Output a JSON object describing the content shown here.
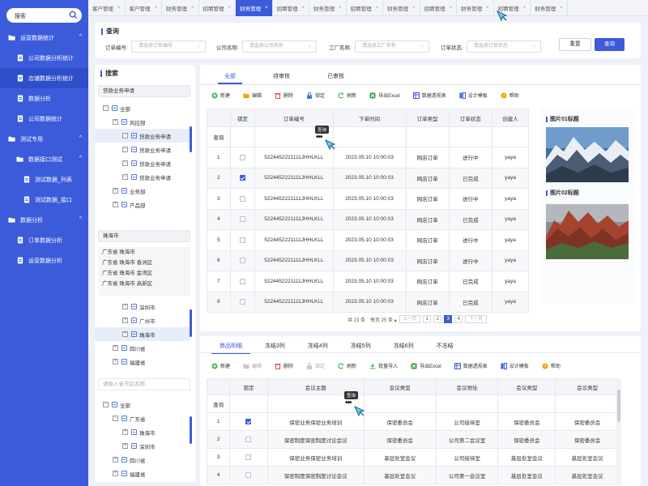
{
  "sidebar": {
    "search_placeholder": "搜索",
    "items": [
      {
        "label": "运营数据统计",
        "level": 0,
        "icon": "folder-icon",
        "caret": "^"
      },
      {
        "label": "公司数据分析统计",
        "level": 1,
        "icon": "doc-icon"
      },
      {
        "label": "店铺数据分析统计",
        "level": 1,
        "icon": "doc-icon",
        "active": true
      },
      {
        "label": "数据分析",
        "level": 1,
        "icon": "doc-icon"
      },
      {
        "label": "公司数据统计",
        "level": 1,
        "icon": "doc-icon"
      },
      {
        "label": "测试专用",
        "level": 0,
        "icon": "folder-icon",
        "caret": "^"
      },
      {
        "label": "数据接口测试",
        "level": 1,
        "icon": "folder-icon",
        "caret": "^"
      },
      {
        "label": "测试数据_列表",
        "level": 2,
        "icon": "doc-icon"
      },
      {
        "label": "测试数据_接口",
        "level": 2,
        "icon": "doc-icon"
      },
      {
        "label": "数据分析",
        "level": 0,
        "icon": "folder-icon",
        "caret": "^"
      },
      {
        "label": "订单数据分析",
        "level": 1,
        "icon": "doc-icon"
      },
      {
        "label": "运营数据分析",
        "level": 1,
        "icon": "doc-icon"
      }
    ]
  },
  "tabs": [
    {
      "label": "客户管理"
    },
    {
      "label": "客户管理"
    },
    {
      "label": "财务管理"
    },
    {
      "label": "招聘管理"
    },
    {
      "label": "财务管理",
      "active": true
    },
    {
      "label": "招聘管理"
    },
    {
      "label": "财务管理"
    },
    {
      "label": "招聘管理"
    },
    {
      "label": "财务管理"
    },
    {
      "label": "招聘管理"
    },
    {
      "label": "财务管理"
    },
    {
      "label": "招聘管理"
    },
    {
      "label": "财务管理"
    }
  ],
  "tab_close": "×",
  "query": {
    "title": "查询",
    "fields": [
      {
        "label": "订单编号:",
        "placeholder": "请选择订单编号"
      },
      {
        "label": "公司名称:",
        "placeholder": "请选择公司名称"
      },
      {
        "label": "工厂名称:",
        "placeholder": "请选择工厂名称"
      },
      {
        "label": "订单状态:",
        "placeholder": "请选择订单状态"
      }
    ],
    "reset_label": "重置",
    "search_label": "查询"
  },
  "leftpanel": {
    "title": "搜索",
    "dept_input": "贷款业务申请",
    "dept_tree": [
      {
        "label": "全部",
        "toggle": "−",
        "indent": 0
      },
      {
        "label": "风控部",
        "toggle": "+",
        "indent": 1
      },
      {
        "label": "贷款业务申请",
        "toggle": "−",
        "indent": 2,
        "sel": true
      },
      {
        "label": "贷款业务申请",
        "toggle": "−",
        "indent": 2
      },
      {
        "label": "贷款业务申请",
        "toggle": "−",
        "indent": 2
      },
      {
        "label": "贷款业务申请",
        "toggle": "−",
        "indent": 2
      },
      {
        "label": "业务部",
        "toggle": "+",
        "indent": 1
      },
      {
        "label": "产品部",
        "toggle": "+",
        "indent": 1
      }
    ],
    "city_input": "珠海市",
    "region_lines": [
      "广东省 珠海市",
      "广东省 珠海市 香洲区",
      "广东省 珠海市 金湾区",
      "广东省 珠海市 高新区"
    ],
    "city_tree": [
      {
        "label": "深圳市",
        "toggle": "+",
        "indent": 2
      },
      {
        "label": "广州市",
        "toggle": "+",
        "indent": 2
      },
      {
        "label": "珠海市",
        "toggle": "+",
        "indent": 2,
        "sel": true
      },
      {
        "label": "四川省",
        "toggle": "+",
        "indent": 1
      },
      {
        "label": "福建省",
        "toggle": "+",
        "indent": 1
      }
    ],
    "province_placeholder": "请输入省市区名称",
    "prov_tree": [
      {
        "label": "全部",
        "toggle": "−",
        "indent": 0
      },
      {
        "label": "广东省",
        "toggle": "−",
        "indent": 1
      },
      {
        "label": "珠海市",
        "toggle": "+",
        "indent": 2
      },
      {
        "label": "深圳市",
        "toggle": "+",
        "indent": 2
      },
      {
        "label": "四川省",
        "toggle": "+",
        "indent": 1
      },
      {
        "label": "福建省",
        "toggle": "+",
        "indent": 1
      }
    ]
  },
  "main": {
    "subtabs": [
      "全部",
      "待审核",
      "已审核"
    ],
    "toolbar": [
      {
        "label": "新建",
        "icon": "plus-circle-icon",
        "color": "#3cb44b"
      },
      {
        "label": "编辑",
        "icon": "folder-edit-icon",
        "color": "#f0a500"
      },
      {
        "label": "删除",
        "icon": "delete-icon",
        "color": "#e04848"
      },
      {
        "label": "锁定",
        "icon": "lock-icon",
        "color": "#3b7ce8"
      },
      {
        "label": "刷新",
        "icon": "refresh-icon",
        "color": "#3cb44b"
      },
      {
        "label": "导出Excel",
        "icon": "excel-icon",
        "color": "#2f9e44"
      },
      {
        "label": "数据透视表",
        "icon": "pivot-icon",
        "color": "#3b5bdb"
      },
      {
        "label": "设计模板",
        "icon": "template-icon",
        "color": "#3b5bdb"
      },
      {
        "label": "帮助",
        "icon": "help-icon",
        "color": "#f0a500"
      }
    ],
    "headers": [
      "",
      "锁定",
      "订单编号",
      "下单时间",
      "订单类型",
      "订单状态",
      "创建人"
    ],
    "filter_label": "查询",
    "tooltip": "查询",
    "dots": "•••",
    "rows": [
      {
        "n": "1",
        "checked": false,
        "order": "5224452221111JHHLKLL",
        "time": "2023.05.10 10:00:03",
        "type": "网店订单",
        "status": "进行中",
        "status_kind": "run",
        "creator": "yaya"
      },
      {
        "n": "2",
        "checked": true,
        "order": "5224452221111JHHLKLL",
        "time": "2023.05.10 10:00:03",
        "type": "网店订单",
        "status": "已完成",
        "status_kind": "done",
        "creator": "yaya"
      },
      {
        "n": "3",
        "checked": false,
        "order": "5224452221111JHHLKLL",
        "time": "2023.05.10 10:00:03",
        "type": "网店订单",
        "status": "进行中",
        "status_kind": "run",
        "creator": "yaya"
      },
      {
        "n": "4",
        "checked": false,
        "order": "5224452221111JHHLKLL",
        "time": "2023.05.10 10:00:03",
        "type": "网店订单",
        "status": "已完成",
        "status_kind": "done",
        "creator": "yaya"
      },
      {
        "n": "5",
        "checked": false,
        "order": "5224452221111JHHLKLL",
        "time": "2023.05.10 10:00:03",
        "type": "网店订单",
        "status": "进行中",
        "status_kind": "run",
        "creator": "yaya"
      },
      {
        "n": "6",
        "checked": false,
        "order": "5224452221111JHHLKLL",
        "time": "2023.05.10 10:00:03",
        "type": "网店订单",
        "status": "进行中",
        "status_kind": "run",
        "creator": "yaya"
      },
      {
        "n": "7",
        "checked": false,
        "order": "5224452221111JHHLKLL",
        "time": "2023.05.10 10:00:03",
        "type": "网店订单",
        "status": "已完成",
        "status_kind": "done",
        "creator": "yaya"
      },
      {
        "n": "8",
        "checked": false,
        "order": "5224452221111JHHLKLL",
        "time": "2023.05.10 10:00:03",
        "type": "网店订单",
        "status": "已完成",
        "status_kind": "done",
        "creator": "yaya"
      }
    ],
    "pager": {
      "total": "共 23 条",
      "per_page": "每页 25 条",
      "prev": "上一页",
      "pages": [
        "1",
        "2",
        "3",
        "4"
      ],
      "current": "3",
      "next": "下一页"
    }
  },
  "images": {
    "title1": "图片01标题",
    "title2": "图片02标题"
  },
  "bottom": {
    "tabs": [
      "商品明细",
      "冻结3列",
      "冻结4列",
      "冻结5列",
      "冻结6列",
      "不冻结"
    ],
    "toolbar": [
      {
        "label": "新建",
        "icon": "plus-circle-icon",
        "color": "#3cb44b"
      },
      {
        "label": "编辑",
        "icon": "folder-edit-icon",
        "color": "#c8c8c8",
        "dim": true
      },
      {
        "label": "删除",
        "icon": "delete-icon",
        "color": "#e04848"
      },
      {
        "label": "锁定",
        "icon": "lock-icon",
        "color": "#c8c8c8",
        "dim": true
      },
      {
        "label": "刷新",
        "icon": "refresh-icon",
        "color": "#3cb44b"
      },
      {
        "label": "批量导入",
        "icon": "import-icon",
        "color": "#3cb44b"
      },
      {
        "label": "导出Excel",
        "icon": "excel-icon",
        "color": "#2f9e44"
      },
      {
        "label": "数据透视表",
        "icon": "pivot-icon",
        "color": "#3b5bdb"
      },
      {
        "label": "设计模板",
        "icon": "template-icon",
        "color": "#3b5bdb"
      },
      {
        "label": "帮助",
        "icon": "help-icon",
        "color": "#f0a500"
      }
    ],
    "headers": [
      "",
      "锁定",
      "会议主题",
      "会议类型",
      "会议地址",
      "会议类型",
      "会议类型"
    ],
    "filter_label": "查询",
    "tooltip": "查询",
    "dots": "•••",
    "rows": [
      {
        "n": "1",
        "checked": true,
        "topic": "保密业务保密业务培训",
        "type": "保密委员会",
        "addr": "公司接待室",
        "t2": "保密委员会",
        "t3": "保密委员会"
      },
      {
        "n": "2",
        "checked": false,
        "topic": "保密制度保密制度讨论会议",
        "type": "保密委员会",
        "addr": "公司第二会议室",
        "t2": "保密委员会",
        "t3": "保密委员会"
      },
      {
        "n": "3",
        "checked": false,
        "topic": "保密业务保密业务培训",
        "type": "基层处室会议",
        "addr": "公司接待室",
        "t2": "基层处室会议",
        "t3": "基层处室会议"
      },
      {
        "n": "4",
        "checked": false,
        "topic": "保密制度保密制度讨论会议",
        "type": "基层处室会议",
        "addr": "公司第一会议室",
        "t2": "基层处室会议",
        "t3": "基层处室会议"
      }
    ]
  }
}
